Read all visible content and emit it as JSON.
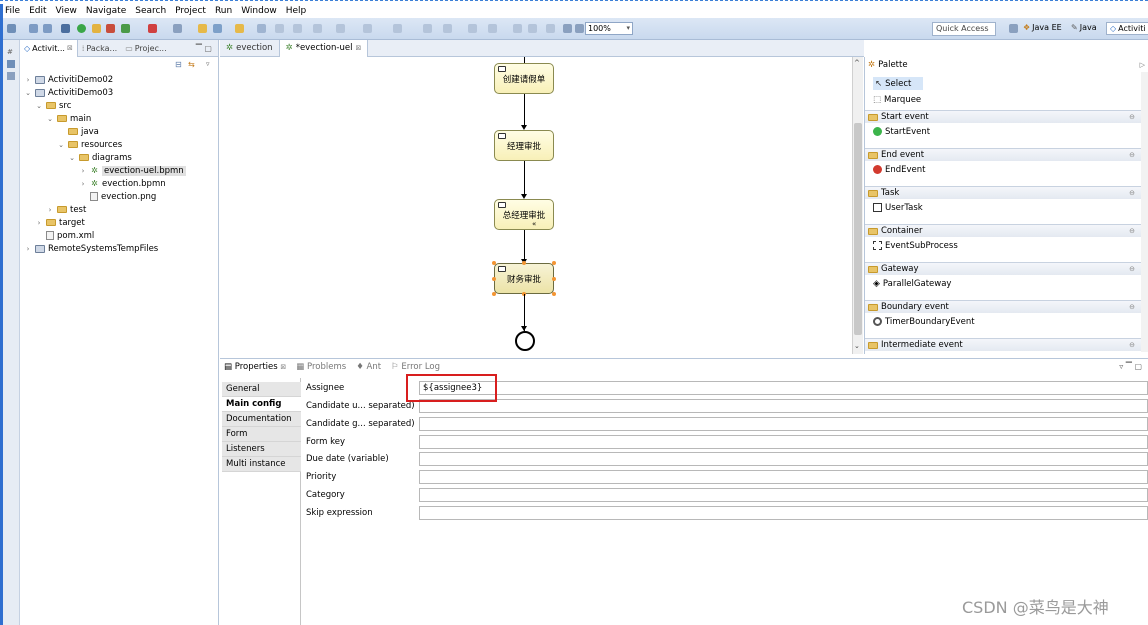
{
  "menu": [
    "File",
    "Edit",
    "View",
    "Navigate",
    "Search",
    "Project",
    "Run",
    "Window",
    "Help"
  ],
  "toolbar": {
    "zoom": "100%",
    "quick_access": "Quick Access",
    "perspectives": [
      "Java EE",
      "Java",
      "Activiti"
    ]
  },
  "explorer": {
    "tabs": [
      "Activit...",
      "Packa...",
      "Projec..."
    ],
    "tree": [
      "ActivitiDemo02",
      "ActivitiDemo03",
      "src",
      "main",
      "java",
      "resources",
      "diagrams",
      "evection-uel.bpmn",
      "evection.bpmn",
      "evection.png",
      "test",
      "target",
      "pom.xml",
      "RemoteSystemsTempFiles"
    ]
  },
  "editor": {
    "tabs": [
      "evection",
      "*evection-uel"
    ]
  },
  "diagram": {
    "tasks": [
      "创建请假单",
      "经理审批",
      "总经理审批",
      "财务审批"
    ]
  },
  "palette": {
    "title": "Palette",
    "tools": [
      "Select",
      "Marquee"
    ],
    "categories": [
      {
        "name": "Start event",
        "item": "StartEvent"
      },
      {
        "name": "End event",
        "item": "EndEvent"
      },
      {
        "name": "Task",
        "item": "UserTask"
      },
      {
        "name": "Container",
        "item": "EventSubProcess"
      },
      {
        "name": "Gateway",
        "item": "ParallelGateway"
      },
      {
        "name": "Boundary event",
        "item": "TimerBoundaryEvent"
      },
      {
        "name": "Intermediate event",
        "item": ""
      }
    ]
  },
  "properties": {
    "tabs": [
      "Properties",
      "Problems",
      "Ant",
      "Error Log"
    ],
    "sections": [
      "General",
      "Main config",
      "Documentation",
      "Form",
      "Listeners",
      "Multi instance"
    ],
    "fields": [
      {
        "label": "Assignee",
        "value": "${assignee3}"
      },
      {
        "label": "Candidate u... separated)",
        "value": ""
      },
      {
        "label": "Candidate g... separated)",
        "value": ""
      },
      {
        "label": "Form key",
        "value": ""
      },
      {
        "label": "Due date (variable)",
        "value": ""
      },
      {
        "label": "Priority",
        "value": ""
      },
      {
        "label": "Category",
        "value": ""
      },
      {
        "label": "Skip expression",
        "value": ""
      }
    ]
  },
  "watermark": "CSDN @菜鸟是大神"
}
